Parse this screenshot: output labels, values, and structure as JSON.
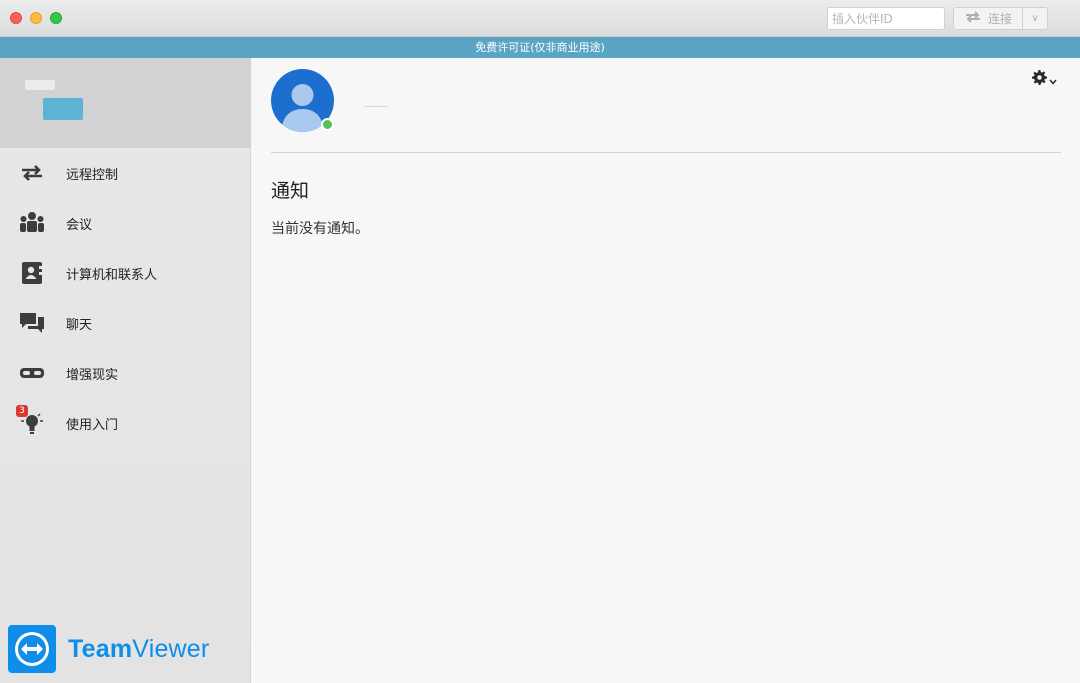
{
  "titlebar": {
    "partner_id_placeholder": "插入伙伴ID",
    "connect_label": "连接",
    "dropdown_glyph": "∨"
  },
  "license": {
    "text": "免费许可证(仅非商业用途)"
  },
  "sidebar": {
    "items": [
      {
        "label": "远程控制",
        "icon": "remote-control-arrows-icon"
      },
      {
        "label": "会议",
        "icon": "meeting-people-icon"
      },
      {
        "label": "计算机和联系人",
        "icon": "contacts-book-icon"
      },
      {
        "label": "聊天",
        "icon": "chat-bubbles-icon"
      },
      {
        "label": "增强现实",
        "icon": "ar-glasses-icon"
      },
      {
        "label": "使用入门",
        "icon": "lightbulb-icon",
        "badge": "3"
      }
    ],
    "brand": {
      "part1": "Team",
      "part2": "Viewer"
    }
  },
  "main": {
    "notification_title": "通知",
    "notification_text": "当前没有通知。",
    "settings_icon": "gear-icon",
    "status_color": "#54c255"
  },
  "colors": {
    "accent": "#0e8ee9",
    "license_bar": "#5aa5c4"
  }
}
